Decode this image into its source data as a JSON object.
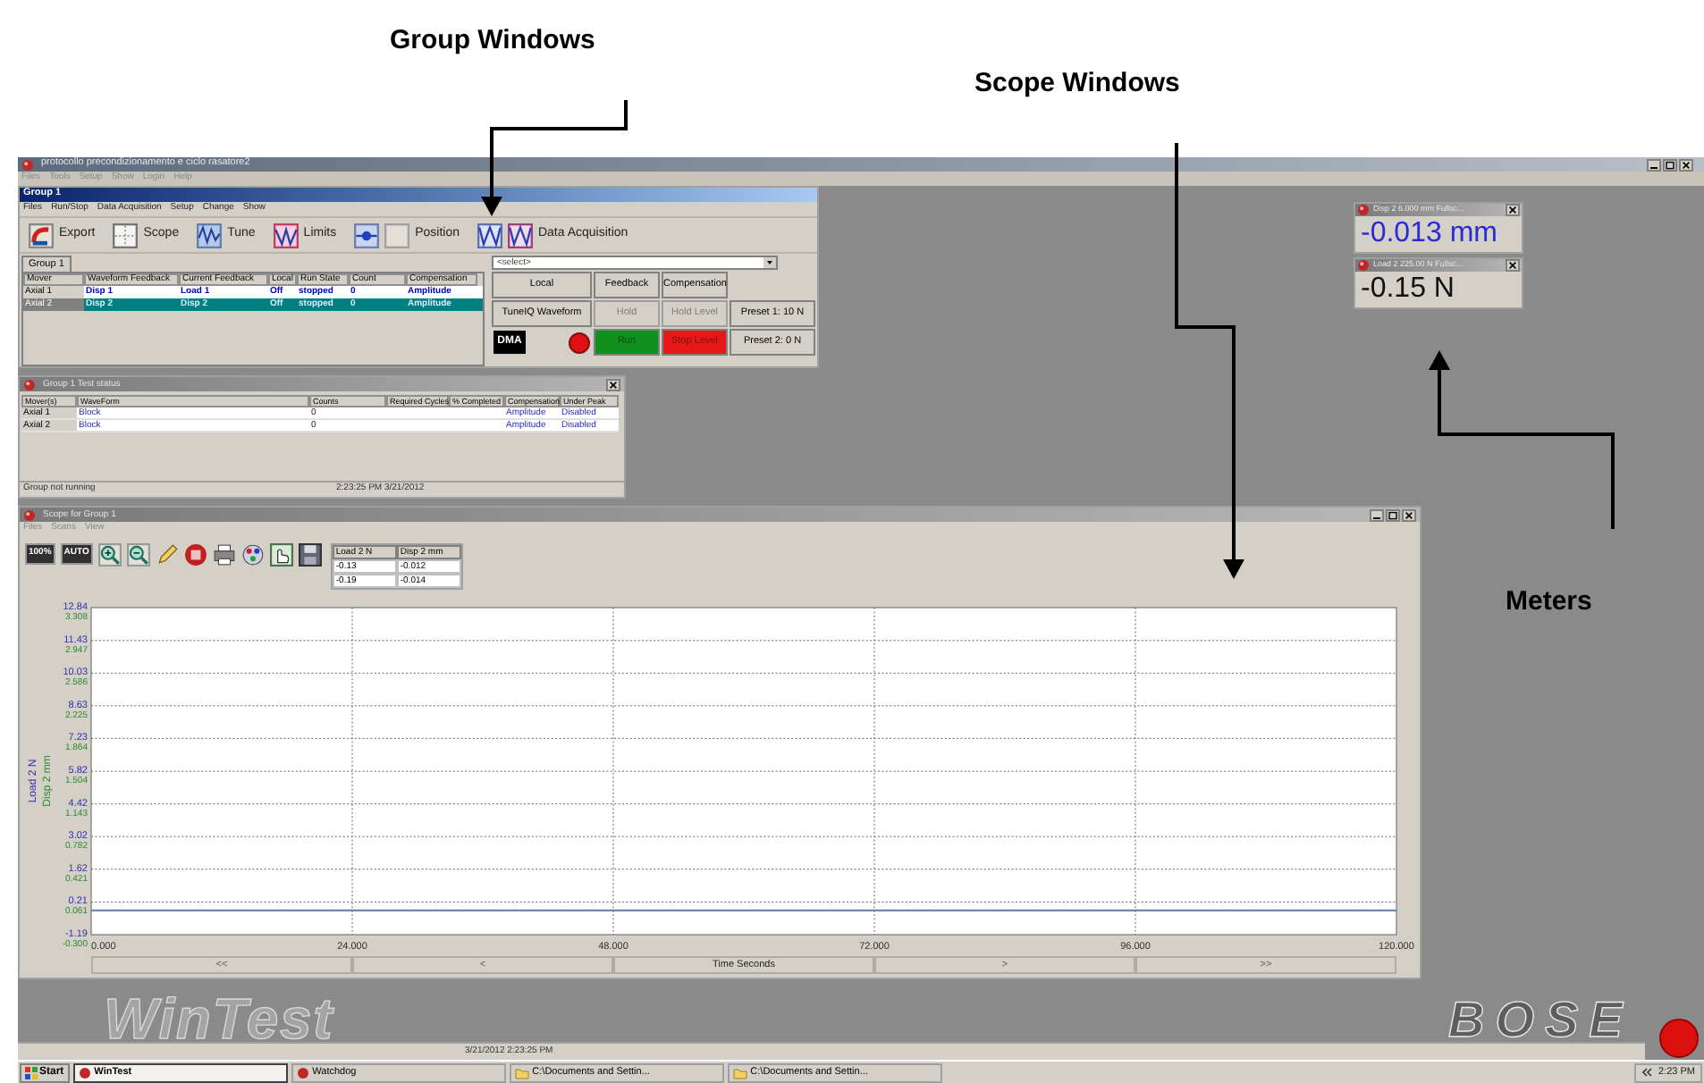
{
  "annotations": [
    {
      "label": "Group Windows"
    },
    {
      "label": "Scope Windows"
    },
    {
      "label": "Meters"
    }
  ],
  "main_window": {
    "title": "protocollo precondizionamento e ciclo rasatore2",
    "menu": [
      "Files",
      "Tools",
      "Setup",
      "Show",
      "Login",
      "Help"
    ]
  },
  "group_window": {
    "title": "Group 1",
    "menu": [
      "Files",
      "Run/Stop",
      "Data Acquisition",
      "Setup",
      "Change",
      "Show"
    ],
    "toolbar": [
      {
        "kind": "export",
        "label": "Export"
      },
      {
        "kind": "scope",
        "label": "Scope"
      },
      {
        "kind": "tune",
        "label": "Tune"
      },
      {
        "kind": "limits",
        "label": "Limits"
      },
      {
        "kind": "position",
        "label": "Position"
      },
      {
        "kind": "acquisition",
        "label": "Data Acquisition"
      }
    ],
    "tabs": [
      {
        "label": "Group 1",
        "selected": true
      }
    ],
    "table": {
      "columns": [
        "Mover",
        "Waveform Feedback",
        "Current Feedback",
        "Local",
        "Run State",
        "Count",
        "Compensation"
      ],
      "rows": [
        {
          "selected": false,
          "cells": [
            "Axial 1",
            "Disp 1",
            "Load 1",
            "Off",
            "stopped",
            "0",
            "Amplitude"
          ]
        },
        {
          "selected": true,
          "cells": [
            "Axial 2",
            "Disp 2",
            "Disp 2",
            "Off",
            "stopped",
            "0",
            "Amplitude"
          ]
        }
      ]
    },
    "select": {
      "value": "<select>"
    },
    "buttons": [
      [
        {
          "kind": "normal",
          "label": "Local"
        },
        {
          "kind": "normal",
          "label": "Feedback"
        },
        {
          "kind": "normal",
          "label": "Compensation"
        }
      ],
      [
        {
          "kind": "normal",
          "label": "TuneIQ Waveform"
        },
        {
          "kind": "disabled",
          "label": "Hold"
        },
        {
          "kind": "disabled",
          "label": "Hold Level"
        },
        {
          "kind": "normal",
          "label": "Preset 1: 10 N"
        }
      ],
      [
        {
          "kind": "logo",
          "label": "DMA"
        },
        {
          "kind": "record"
        },
        {
          "kind": "run",
          "label": "Run"
        },
        {
          "kind": "stop",
          "label": "Stop Level"
        },
        {
          "kind": "normal",
          "label": "Preset 2: 0 N"
        }
      ]
    ]
  },
  "status_window": {
    "title": "Group 1 Test status",
    "columns": [
      "Mover(s)",
      "WaveForm",
      "Counts",
      "Required Cycles",
      "% Completed",
      "Compensation",
      "Under Peak"
    ],
    "rows": [
      {
        "mover": "Axial 1",
        "waveform": "Block",
        "counts": "0",
        "compensation": "Amplitude",
        "under_peak": "Disabled"
      },
      {
        "mover": "Axial 2",
        "waveform": "Block",
        "counts": "0",
        "compensation": "Amplitude",
        "under_peak": "Disabled"
      }
    ],
    "status": "Group not running",
    "timestamp": "2:23:25 PM  3/21/2012"
  },
  "scope_window": {
    "title": "Scope for Group 1",
    "menu": [
      "Files",
      "Scans",
      "View"
    ],
    "toolbar": [
      {
        "kind": "text",
        "label": "100%"
      },
      {
        "kind": "text",
        "label": "AUTO"
      },
      {
        "kind": "zoom-in"
      },
      {
        "kind": "zoom-out"
      },
      {
        "kind": "pencil"
      },
      {
        "kind": "stop"
      },
      {
        "kind": "printer"
      },
      {
        "kind": "palette"
      },
      {
        "kind": "hand"
      },
      {
        "kind": "save"
      }
    ],
    "readout": {
      "columns": [
        "Load 2 N",
        "Disp 2 mm"
      ],
      "rows": [
        [
          "-0.13",
          "-0.012"
        ],
        [
          "-0.19",
          "-0.014"
        ]
      ]
    },
    "chart_data": {
      "type": "line",
      "grid": true,
      "xlabel": "Time Seconds",
      "x": [
        0,
        120
      ],
      "series": [
        {
          "name": "Load 2 N",
          "color": "#7089a8",
          "values": [
            -0.15,
            -0.15
          ]
        }
      ],
      "xlim": [
        0,
        120
      ],
      "ylim": [
        -1.19,
        12.84
      ],
      "xticks": [
        {
          "value": 0,
          "label": "0.000"
        },
        {
          "value": 24,
          "label": "24.000"
        },
        {
          "value": 48,
          "label": "48.000"
        },
        {
          "value": 72,
          "label": "72.000"
        },
        {
          "value": 96,
          "label": "96.000"
        },
        {
          "value": 120,
          "label": "120.000"
        }
      ],
      "yticks": [
        {
          "value": 12.84,
          "label": "12.84"
        },
        {
          "value": 11.43,
          "label": "11.43"
        },
        {
          "value": 10.03,
          "label": "10.03"
        },
        {
          "value": 8.63,
          "label": "8.63"
        },
        {
          "value": 7.23,
          "label": "7.23"
        },
        {
          "value": 5.82,
          "label": "5.82"
        },
        {
          "value": 4.42,
          "label": "4.42"
        },
        {
          "value": 3.02,
          "label": "3.02"
        },
        {
          "value": 1.62,
          "label": "1.62"
        },
        {
          "value": 0.21,
          "label": "0.21"
        },
        {
          "value": -1.19,
          "label": "-1.19"
        }
      ]
    },
    "secondary_axis": {
      "label": "Disp 2 mm",
      "ticks": [
        "3.308",
        "2.947",
        "2.586",
        "2.225",
        "1.864",
        "1.504",
        "1.143",
        "0.782",
        "0.421",
        "0.061",
        "-0.300"
      ]
    },
    "nav": [
      "<<",
      "<",
      ">",
      ">>"
    ]
  },
  "meters": [
    {
      "title": "Disp 2 6.000 mm Fullsc...",
      "value": "-0.013 mm",
      "color": "#2a2ad8"
    },
    {
      "title": "Load 2 225.00 N Fullsc...",
      "value": "-0.15 N",
      "color": "#111111"
    }
  ],
  "desktop": {
    "logo": "WinTest",
    "brand": "BOSE",
    "status_strip": "3/21/2012 2:23:25 PM"
  },
  "taskbar": {
    "start": "Start",
    "items": [
      {
        "kind": "app",
        "label": "WinTest",
        "selected": true
      },
      {
        "kind": "app",
        "label": "Watchdog",
        "selected": false
      },
      {
        "kind": "folder",
        "label": "C:\\Documents and Settin...",
        "selected": false
      },
      {
        "kind": "folder",
        "label": "C:\\Documents and Settin...",
        "selected": false
      }
    ],
    "clock": "2:23 PM"
  }
}
